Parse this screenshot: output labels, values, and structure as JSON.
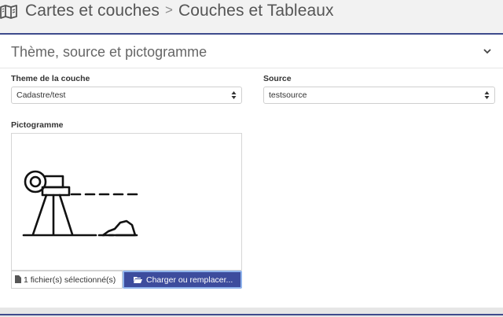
{
  "header": {
    "breadcrumb_root": "Cartes et couches",
    "breadcrumb_separator": ">",
    "breadcrumb_current": "Couches et Tableaux",
    "icon": "map-icon"
  },
  "panel": {
    "title": "Thème, source et pictogramme",
    "toggle_icon": "chevron-down-icon",
    "accent_color": "#3f4b8c"
  },
  "fields": {
    "theme_label": "Theme de la couche",
    "theme_value": "Cadastre/test",
    "source_label": "Source",
    "source_value": "testsource",
    "picto_label": "Pictogramme",
    "picto_image": "surveyor-level-icon"
  },
  "upload": {
    "file_status": "1 fichier(s) sélectionné(s)",
    "button_label": "Charger ou remplacer...",
    "button_color": "#3d4c9d"
  }
}
